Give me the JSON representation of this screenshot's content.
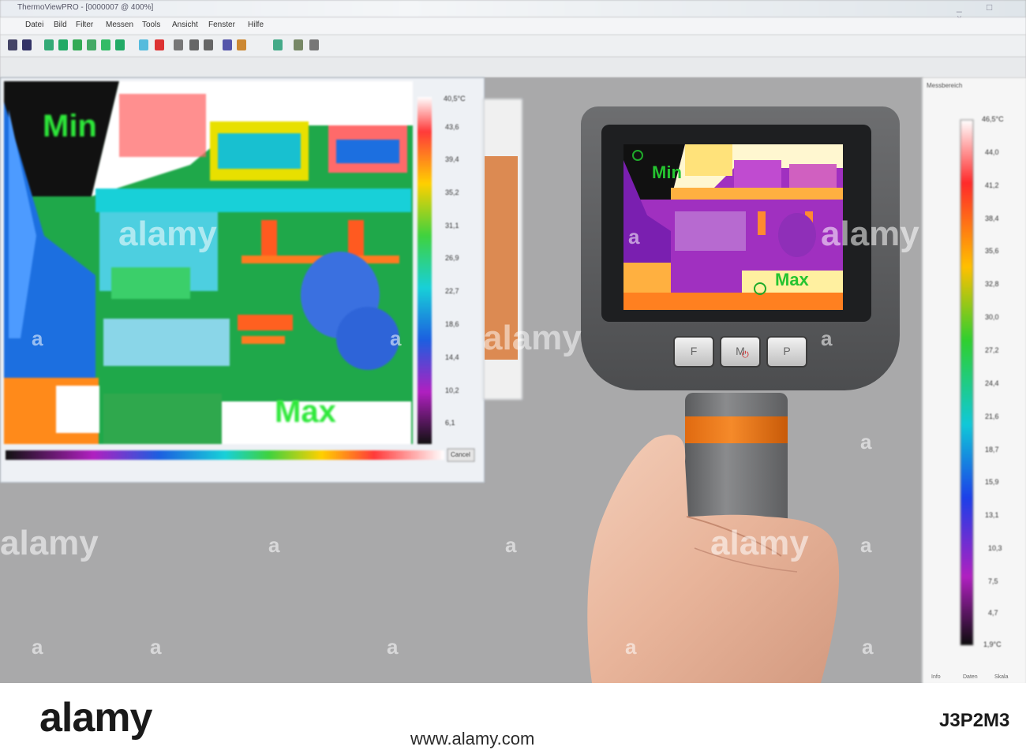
{
  "window": {
    "title": "ThermoViewPRO - [0000007 @ 400%]",
    "controls": "_ □ ×"
  },
  "menu": [
    "Datei",
    "Bild",
    "Filter",
    "Messen",
    "Tools",
    "Ansicht",
    "Fenster",
    "Hilfe"
  ],
  "left_window": {
    "min_label": "Min",
    "max_label": "Max",
    "scale_top": "40,5°C",
    "scale_values": [
      "43,6",
      "39,4",
      "35,2",
      "31,1",
      "26,9",
      "22,7",
      "18,6",
      "14,4",
      "10,2",
      "6,1"
    ],
    "cancel_button": "Cancel"
  },
  "device": {
    "min_label": "Min",
    "max_label": "Max",
    "buttons": [
      "F",
      "M",
      "P"
    ]
  },
  "right_panel": {
    "title": "Messbereich",
    "scale_top": "46,5°C",
    "scale_values": [
      "44,0",
      "41,2",
      "38,4",
      "35,6",
      "32,8",
      "30,0",
      "27,2",
      "24,4",
      "21,6",
      "18,7",
      "15,9",
      "13,1",
      "10,3",
      "7,5",
      "4,7"
    ],
    "scale_bottom": "1,9°C",
    "tabs": [
      "Info",
      "Daten",
      "Skala"
    ]
  },
  "watermarks": [
    "alamy",
    "alamy",
    "alamy",
    "alamy",
    "alamy",
    "a",
    "a",
    "a",
    "a",
    "a",
    "a",
    "a",
    "a",
    "a",
    "a",
    "a",
    "a",
    "a"
  ],
  "footer": {
    "logo": "alamy",
    "url": "www.alamy.com",
    "image_id": "J3P2M3"
  },
  "colors": {
    "thermal_orange": "#f58a2a",
    "thermal_magenta": "#a030c0",
    "cold_blue": "#1c6fe0",
    "warm_green": "#1fa84a"
  }
}
